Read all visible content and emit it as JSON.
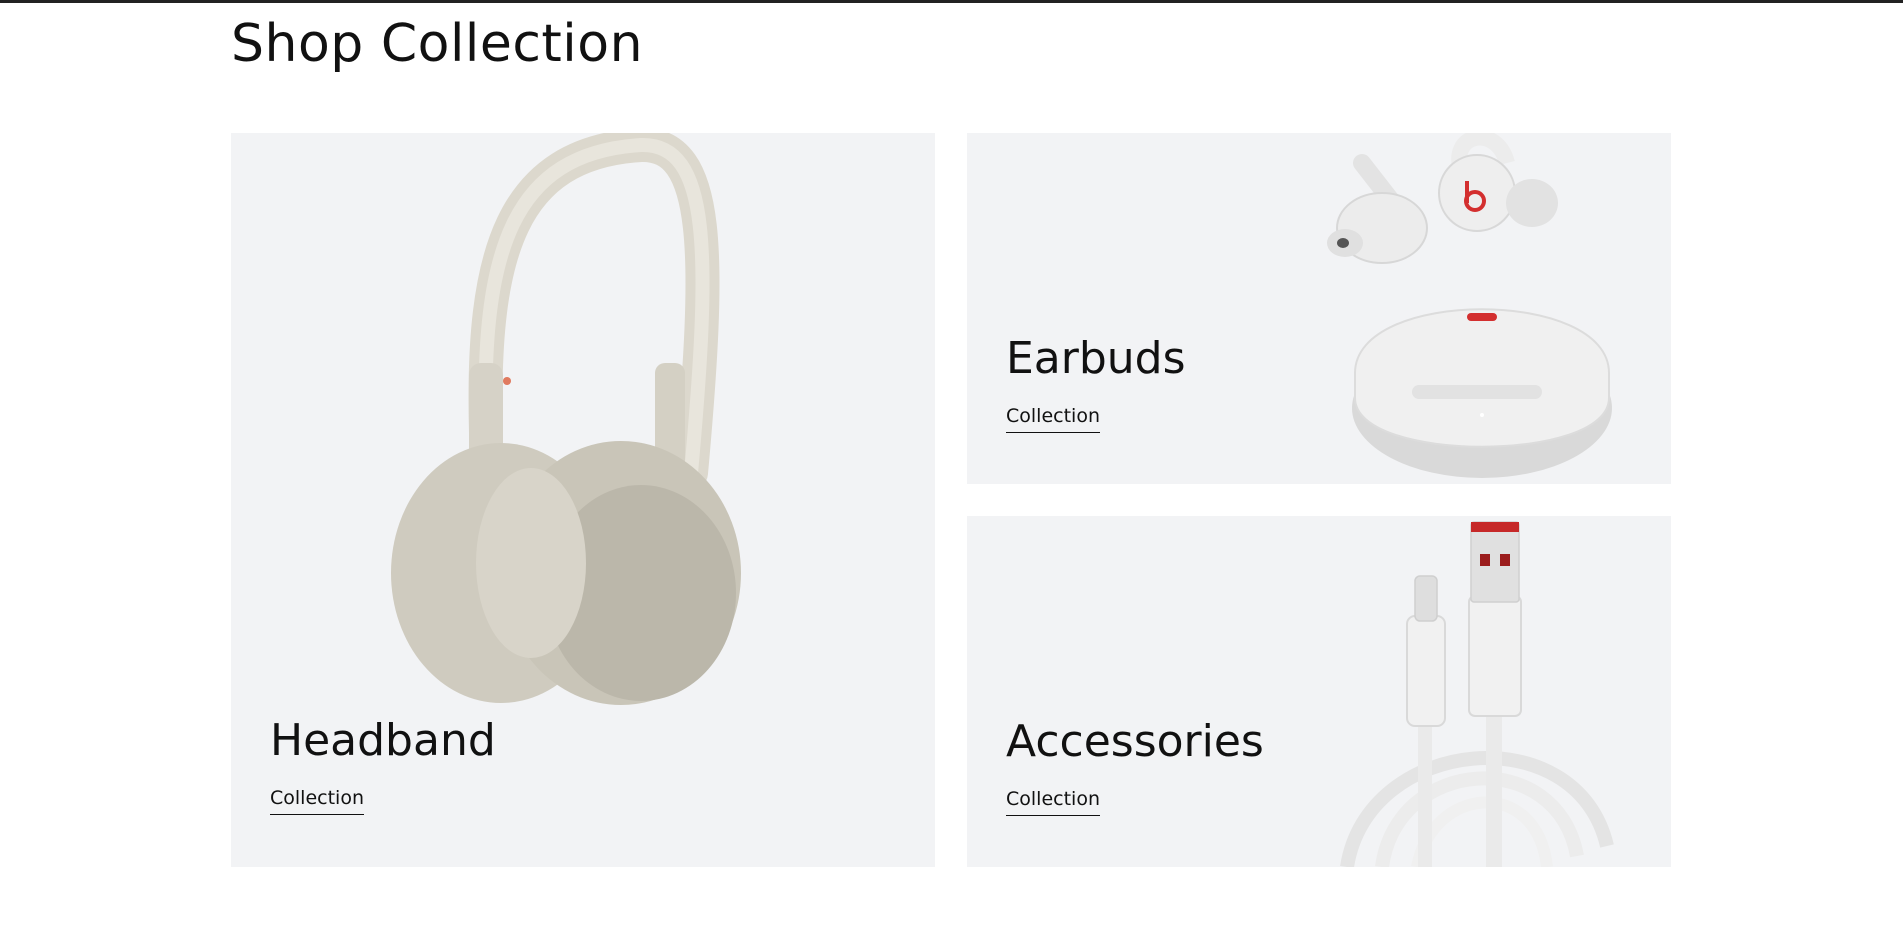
{
  "page": {
    "title": "Shop Collection"
  },
  "collections": [
    {
      "title": "Headband",
      "link": "Collection",
      "image": "headphones-image"
    },
    {
      "title": "Earbuds",
      "link": "Collection",
      "image": "earbuds-image"
    },
    {
      "title": "Accessories",
      "link": "Collection",
      "image": "usb-cable-image"
    }
  ],
  "colors": {
    "card_bg": "#f2f3f5",
    "text": "#111111",
    "beats_red": "#d32f2f"
  }
}
